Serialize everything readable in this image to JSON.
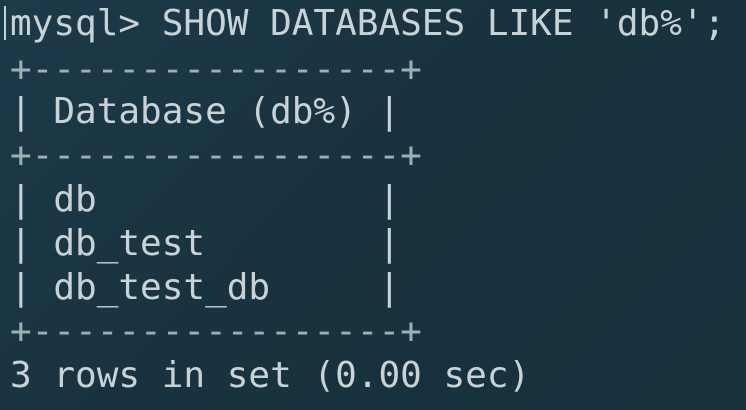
{
  "prompt": "mysql> SHOW DATABASES LIKE 'db%';",
  "table": {
    "border_top": "+-----------------+",
    "header_row": "| Database (db%) |",
    "border_mid": "+-----------------+",
    "rows": [
      "| db             |",
      "| db_test        |",
      "| db_test_db     |"
    ],
    "border_bottom": "+-----------------+"
  },
  "result_summary": "3 rows in set (0.00 sec)",
  "colors": {
    "background": "#1a3441",
    "text": "#c9d3d6"
  }
}
